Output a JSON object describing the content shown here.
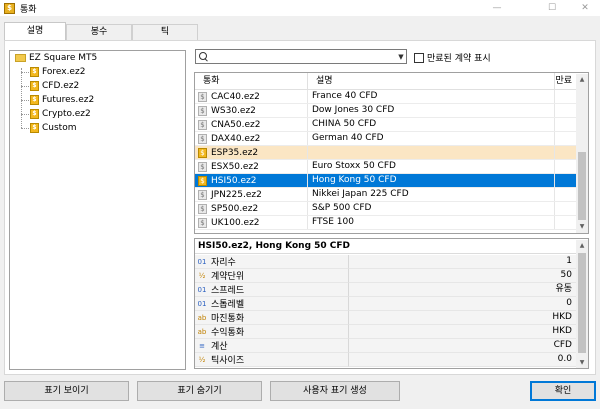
{
  "window": {
    "title": "통화",
    "minimize": "—",
    "maximize": "☐",
    "close": "✕"
  },
  "tabs": [
    {
      "label": "설명",
      "active": true
    },
    {
      "label": "봉수",
      "active": false
    },
    {
      "label": "틱",
      "active": false
    }
  ],
  "tree": {
    "root": "EZ Square MT5",
    "children": [
      "Forex.ez2",
      "CFD.ez2",
      "Futures.ez2",
      "Crypto.ez2",
      "Custom"
    ]
  },
  "search": {
    "value": "",
    "placeholder": ""
  },
  "expired_checkbox": {
    "label": "만료된 계약 표시",
    "checked": false
  },
  "grid": {
    "columns": [
      "통화",
      "설명",
      "만료"
    ],
    "rows": [
      {
        "symbol": "CAC40.ez2",
        "description": "France 40 CFD",
        "expiry": ""
      },
      {
        "symbol": "WS30.ez2",
        "description": "Dow Jones 30 CFD",
        "expiry": ""
      },
      {
        "symbol": "CNA50.ez2",
        "description": "CHINA 50 CFD",
        "expiry": ""
      },
      {
        "symbol": "DAX40.ez2",
        "description": "German 40 CFD",
        "expiry": ""
      },
      {
        "symbol": "ESP35.ez2",
        "description": "",
        "expiry": ""
      },
      {
        "symbol": "ESX50.ez2",
        "description": "Euro Stoxx 50 CFD",
        "expiry": ""
      },
      {
        "symbol": "HSI50.ez2",
        "description": "Hong Kong 50 CFD",
        "expiry": ""
      },
      {
        "symbol": "JPN225.ez2",
        "description": "Nikkei Japan 225 CFD",
        "expiry": ""
      },
      {
        "symbol": "SP500.ez2",
        "description": "S&P 500 CFD",
        "expiry": ""
      },
      {
        "symbol": "UK100.ez2",
        "description": "FTSE 100",
        "expiry": ""
      }
    ],
    "highlighted_row": 4,
    "selected_row": 6
  },
  "properties": {
    "title": "HSI50.ez2, Hong Kong 50 CFD",
    "rows": [
      {
        "icon": "01",
        "key": "자리수",
        "value": "1"
      },
      {
        "icon": "½",
        "key": "계약단위",
        "value": "50"
      },
      {
        "icon": "01",
        "key": "스프레드",
        "value": "유동"
      },
      {
        "icon": "01",
        "key": "스톱레벨",
        "value": "0"
      },
      {
        "icon": "ab",
        "key": "마진통화",
        "value": "HKD"
      },
      {
        "icon": "ab",
        "key": "수익통화",
        "value": "HKD"
      },
      {
        "icon": "≡",
        "key": "계산",
        "value": "CFD"
      },
      {
        "icon": "½",
        "key": "틱사이즈",
        "value": "0.0"
      }
    ]
  },
  "buttons": {
    "show": "표기 보이기",
    "hide": "표기 숨기기",
    "create": "사용자 표기 생성",
    "ok": "확인"
  },
  "colors": {
    "selection": "#0078d7",
    "highlight": "#fbe6c4",
    "symbol_icon": "#f3b81f"
  }
}
